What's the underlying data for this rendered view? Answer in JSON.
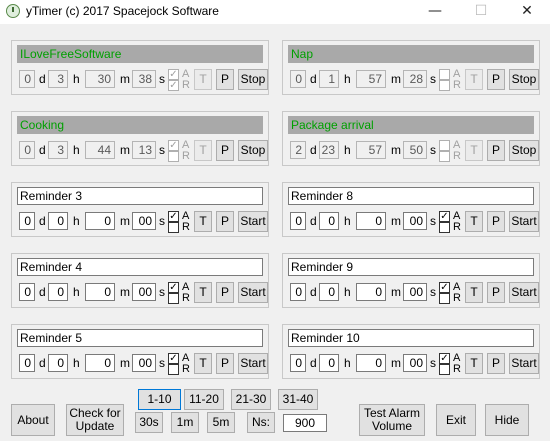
{
  "window": {
    "title": "yTimer (c) 2017 Spacejock Software",
    "minimize": "—",
    "maximize": "☐",
    "close": "✕"
  },
  "labels": {
    "d": "d",
    "h": "h",
    "m": "m",
    "s": "s",
    "a": "A",
    "r": "R",
    "t": "T",
    "p": "P"
  },
  "timers": [
    {
      "name": "ILoveFreeSoftware",
      "days": "0",
      "hours": "3",
      "minutes": "30",
      "seconds": "38",
      "a": true,
      "r": true,
      "action": "Stop",
      "running": true
    },
    {
      "name": "Nap",
      "days": "0",
      "hours": "1",
      "minutes": "57",
      "seconds": "28",
      "a": false,
      "r": false,
      "action": "Stop",
      "running": true
    },
    {
      "name": "Cooking",
      "days": "0",
      "hours": "3",
      "minutes": "44",
      "seconds": "13",
      "a": true,
      "r": false,
      "action": "Stop",
      "running": true
    },
    {
      "name": "Package arrival",
      "days": "2",
      "hours": "23",
      "minutes": "57",
      "seconds": "50",
      "a": false,
      "r": false,
      "action": "Stop",
      "running": true
    },
    {
      "name": "Reminder 3",
      "days": "0",
      "hours": "0",
      "minutes": "0",
      "seconds": "00",
      "a": true,
      "r": false,
      "action": "Start",
      "running": false
    },
    {
      "name": "Reminder 8",
      "days": "0",
      "hours": "0",
      "minutes": "0",
      "seconds": "00",
      "a": true,
      "r": false,
      "action": "Start",
      "running": false
    },
    {
      "name": "Reminder 4",
      "days": "0",
      "hours": "0",
      "minutes": "0",
      "seconds": "00",
      "a": true,
      "r": false,
      "action": "Start",
      "running": false
    },
    {
      "name": "Reminder 9",
      "days": "0",
      "hours": "0",
      "minutes": "0",
      "seconds": "00",
      "a": true,
      "r": false,
      "action": "Start",
      "running": false
    },
    {
      "name": "Reminder 5",
      "days": "0",
      "hours": "0",
      "minutes": "0",
      "seconds": "00",
      "a": true,
      "r": false,
      "action": "Start",
      "running": false
    },
    {
      "name": "Reminder 10",
      "days": "0",
      "hours": "0",
      "minutes": "0",
      "seconds": "00",
      "a": true,
      "r": false,
      "action": "Start",
      "running": false
    }
  ],
  "footer": {
    "about": "About",
    "check_line1": "Check for",
    "check_line2": "Update",
    "pages": [
      "1-10",
      "11-20",
      "21-30",
      "31-40"
    ],
    "quick": [
      "30s",
      "1m",
      "5m"
    ],
    "ns_label": "Ns:",
    "ns_value": "900",
    "test_line1": "Test Alarm",
    "test_line2": "Volume",
    "exit": "Exit",
    "hide": "Hide"
  }
}
